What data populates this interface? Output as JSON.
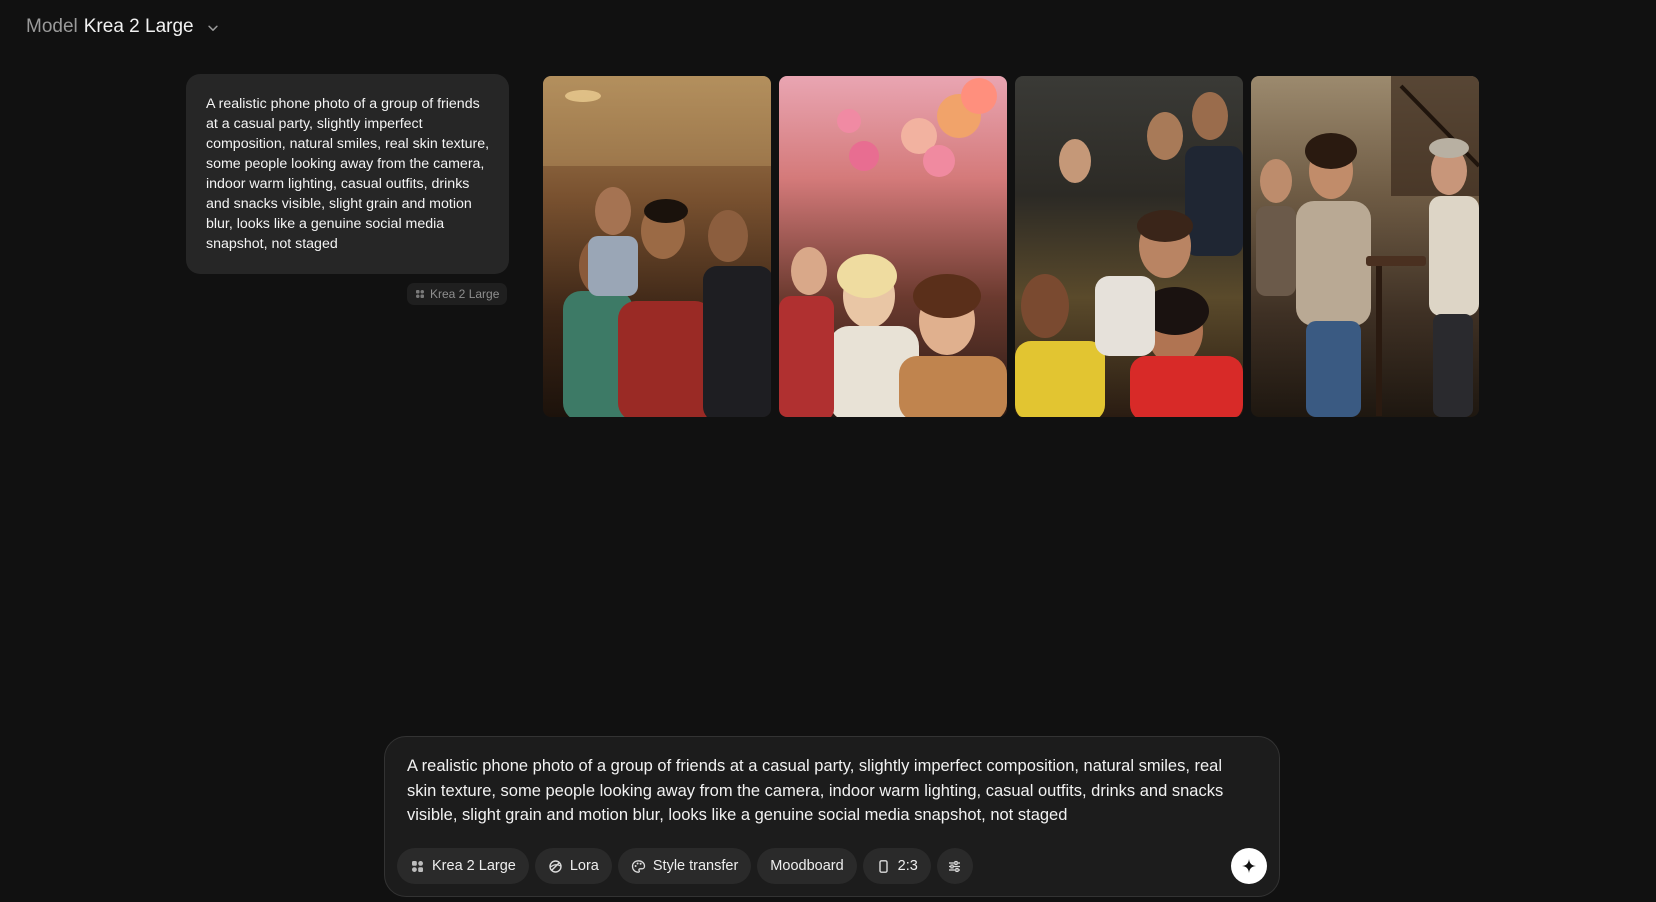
{
  "model_selector": {
    "prefix": "Model",
    "name": "Krea 2 Large",
    "icon": "chevron-down-icon"
  },
  "history": {
    "prompt": "A realistic phone photo of a group of friends at a casual party, slightly imperfect composition, natural smiles, real skin texture, some people looking away from the camera, indoor warm lighting, casual outfits, drinks and snacks visible, slight grain and motion blur, looks like a genuine social media snapshot, not staged",
    "model_tag": "Krea 2 Large",
    "images": [
      {
        "name": "generated-image-1"
      },
      {
        "name": "generated-image-2"
      },
      {
        "name": "generated-image-3"
      },
      {
        "name": "generated-image-4"
      }
    ]
  },
  "composer": {
    "text": "A realistic phone photo of a group of friends at a casual party, slightly imperfect composition, natural smiles, real skin texture, some people looking away from the camera, indoor warm lighting, casual outfits, drinks and snacks visible, slight grain and motion blur, looks like a genuine social media snapshot, not staged",
    "chips": {
      "model": "Krea 2 Large",
      "lora": "Lora",
      "style_transfer": "Style transfer",
      "moodboard": "Moodboard",
      "aspect_ratio": "2:3"
    },
    "icons": [
      "krea-logo-icon",
      "lora-icon",
      "palette-icon",
      "aspect-ratio-icon",
      "sliders-icon",
      "sparkle-icon"
    ]
  },
  "colors": {
    "background": "#111111",
    "bubble": "#262626",
    "chip": "#2a2a2a",
    "submit": "#ffffff"
  }
}
